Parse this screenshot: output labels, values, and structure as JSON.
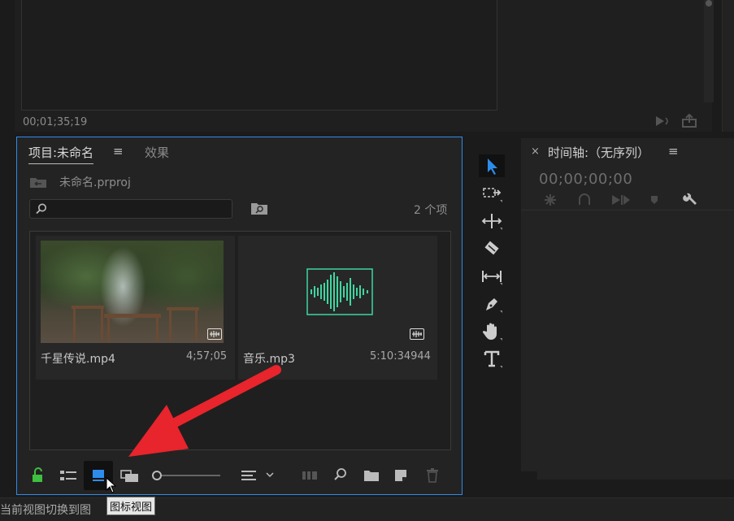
{
  "monitor": {
    "timecode": "00;01;35;19"
  },
  "project_panel": {
    "tab_project": "项目:未命名",
    "tab_menu": "≡",
    "tab_effects": "效果",
    "project_file": "未命名.prproj",
    "search_placeholder": "",
    "item_count": "2 个项",
    "items": [
      {
        "name": "千星传说.mp4",
        "duration": "4;57;05",
        "type": "video"
      },
      {
        "name": "音乐.mp3",
        "duration": "5:10:34944",
        "type": "audio"
      }
    ],
    "toolbar": {
      "lock": "lock-icon",
      "list_view": "list-view-icon",
      "icon_view": "icon-view-icon",
      "freeform_view": "freeform-view-icon",
      "zoom_slider": 0.0,
      "sort": "sort-icon",
      "automate": "automate-to-sequence-icon",
      "find": "search-icon",
      "new_bin": "folder-icon",
      "new_item": "new-item-icon",
      "delete": "trash-icon"
    }
  },
  "tools": [
    "selection-tool-icon",
    "track-select-tool-icon",
    "ripple-edit-tool-icon",
    "razor-tool-icon",
    "slip-tool-icon",
    "pen-tool-icon",
    "hand-tool-icon",
    "type-tool-icon"
  ],
  "timeline": {
    "close": "×",
    "title": "时间轴:（无序列）",
    "menu": "≡",
    "timecode": "00;00;00;00"
  },
  "status": {
    "text": "当前视图切换到图"
  },
  "tooltip": {
    "text": "图标视图"
  },
  "colors": {
    "accent": "#2d8ceb",
    "audio_wave": "#3fd6a0",
    "annotation_arrow": "#e8242c",
    "lock_green": "#3fbf3f"
  }
}
